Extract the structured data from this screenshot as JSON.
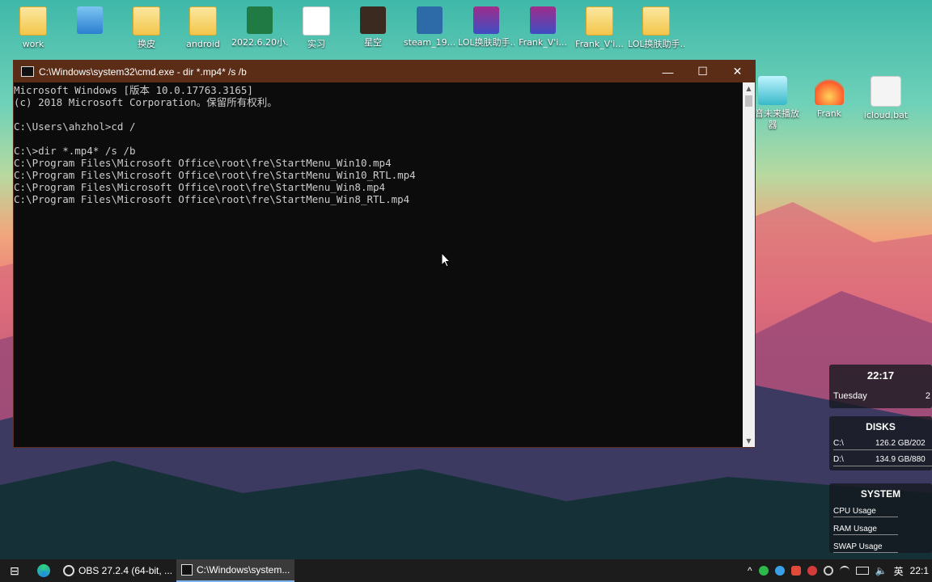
{
  "desktop": {
    "top_icons": [
      {
        "label": "work",
        "kind": "folder"
      },
      {
        "label": "",
        "kind": "appblue"
      },
      {
        "label": "换皮",
        "kind": "folder"
      },
      {
        "label": "android",
        "kind": "folder"
      },
      {
        "label": "2022.6.20小...",
        "kind": "excel"
      },
      {
        "label": "实习",
        "kind": "pdf"
      },
      {
        "label": "星空",
        "kind": "dark"
      },
      {
        "label": "steam_19...",
        "kind": "steam"
      },
      {
        "label": "LOL换肤助手...",
        "kind": "rar"
      },
      {
        "label": "Frank_V'i...",
        "kind": "rar"
      },
      {
        "label": "Frank_V'i...",
        "kind": "folder"
      },
      {
        "label": "LOL换肤助手...",
        "kind": "folder"
      }
    ],
    "right_icons": [
      {
        "label": "初音未来播放器",
        "kind": "miku"
      },
      {
        "label": "Frank",
        "kind": "fire"
      },
      {
        "label": "icloud.bat",
        "kind": "bat"
      }
    ]
  },
  "cmd": {
    "title": "C:\\Windows\\system32\\cmd.exe - dir  *.mp4* /s /b",
    "minimize": "—",
    "maximize": "☐",
    "close": "✕",
    "lines": [
      "Microsoft Windows [版本 10.0.17763.3165]",
      "(c) 2018 Microsoft Corporation。保留所有权利。",
      "",
      "C:\\Users\\ahzhol>cd /",
      "",
      "C:\\>dir *.mp4* /s /b",
      "C:\\Program Files\\Microsoft Office\\root\\fre\\StartMenu_Win10.mp4",
      "C:\\Program Files\\Microsoft Office\\root\\fre\\StartMenu_Win10_RTL.mp4",
      "C:\\Program Files\\Microsoft Office\\root\\fre\\StartMenu_Win8.mp4",
      "C:\\Program Files\\Microsoft Office\\root\\fre\\StartMenu_Win8_RTL.mp4"
    ]
  },
  "widgets": {
    "clock": {
      "time": "22:17",
      "day": "Tuesday",
      "day_suffix": "2"
    },
    "disks": {
      "title": "DISKS",
      "rows": [
        {
          "drive": "C:\\",
          "value": "126.2 GB/202"
        },
        {
          "drive": "D:\\",
          "value": "134.9 GB/880"
        }
      ]
    },
    "system": {
      "title": "SYSTEM",
      "rows": [
        "CPU Usage",
        "RAM Usage",
        "SWAP Usage"
      ]
    }
  },
  "taskbar": {
    "task_view_icon": "⊟",
    "apps": [
      {
        "label": "OBS 27.2.4 (64-bit, ...",
        "active": false
      },
      {
        "label": "C:\\Windows\\system...",
        "active": true
      }
    ],
    "tray": {
      "chevron": "^",
      "ime": "英",
      "clock": "22:1"
    }
  }
}
